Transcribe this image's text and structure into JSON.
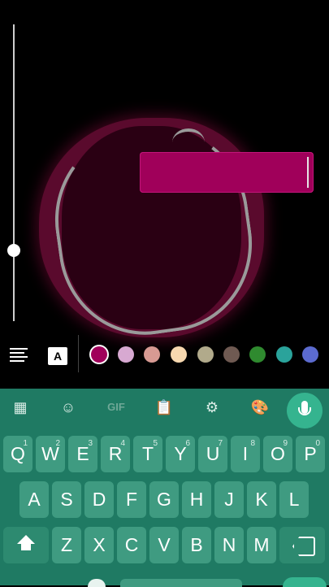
{
  "editor": {
    "accent": "#a0005a",
    "text_input_value": "",
    "brush_size_level": 0.27
  },
  "toolbar": {
    "align_icon": "align-justify-icon",
    "font_bg_label": "A",
    "colors": [
      "#a0005a",
      "#d7a9d1",
      "#d79a93",
      "#f7d8b0",
      "#b1aa8b",
      "#6f5a52",
      "#2f8a2f",
      "#2aa39b",
      "#5c6bcf"
    ],
    "selected_color_index": 0
  },
  "keyboard": {
    "toolbar_icons": [
      "apps-grid-icon",
      "sticker-icon",
      "gif-icon",
      "clipboard-icon",
      "settings-gear-icon",
      "palette-icon",
      "microphone-icon"
    ],
    "gif_label": "GIF",
    "row1": [
      {
        "k": "Q",
        "n": "1"
      },
      {
        "k": "W",
        "n": "2"
      },
      {
        "k": "E",
        "n": "3"
      },
      {
        "k": "R",
        "n": "4"
      },
      {
        "k": "T",
        "n": "5"
      },
      {
        "k": "Y",
        "n": "6"
      },
      {
        "k": "U",
        "n": "7"
      },
      {
        "k": "I",
        "n": "8"
      },
      {
        "k": "O",
        "n": "9"
      },
      {
        "k": "P",
        "n": "0"
      }
    ],
    "row2": [
      "A",
      "S",
      "D",
      "F",
      "G",
      "H",
      "J",
      "K",
      "L"
    ],
    "row3": [
      "Z",
      "X",
      "C",
      "V",
      "B",
      "N",
      "M"
    ]
  }
}
